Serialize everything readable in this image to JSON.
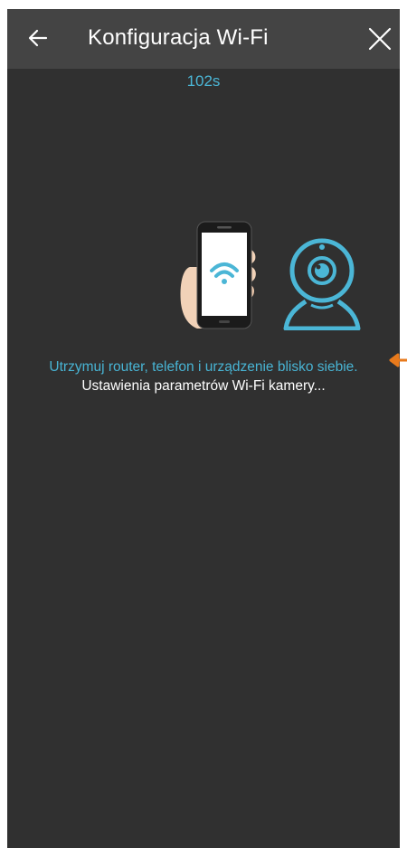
{
  "appbar": {
    "title": "Konfiguracja Wi-Fi",
    "back_icon": "arrow-left-icon",
    "close_icon": "close-icon"
  },
  "countdown": "102s",
  "illustration": {
    "phone_icon": "phone-wifi-icon",
    "camera_icon": "webcam-icon"
  },
  "messages": {
    "hint": "Utrzymuj router, telefon i urządzenie blisko siebie.",
    "status": "Ustawienia parametrów Wi-Fi kamery..."
  },
  "colors": {
    "background": "#303030",
    "appbar": "#444444",
    "accent": "#4bb6d6",
    "annotation_arrow": "#e87a1c"
  }
}
